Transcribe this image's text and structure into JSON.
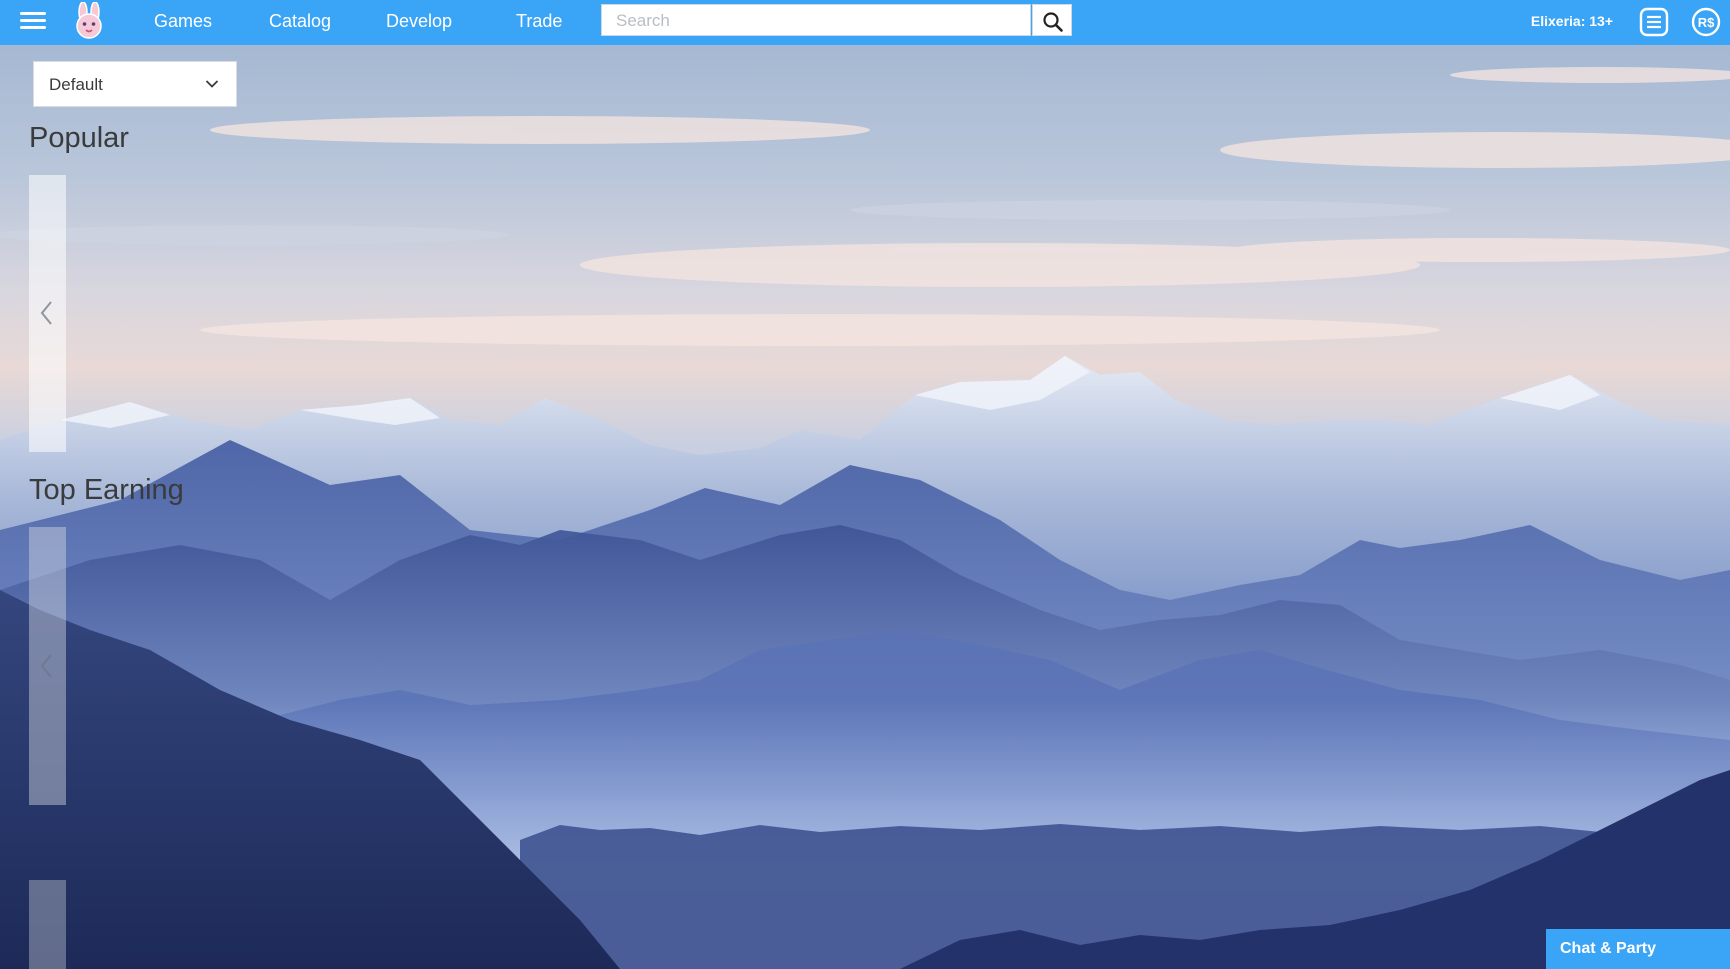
{
  "nav": {
    "games": "Games",
    "catalog": "Catalog",
    "develop": "Develop",
    "trade": "Trade",
    "user": "Elixeria: 13+",
    "icons": [
      "hamburger-icon",
      "bunny-logo-icon",
      "search-icon",
      "messages-icon",
      "robux-icon"
    ]
  },
  "search": {
    "placeholder": "Search",
    "value": ""
  },
  "sort": {
    "selected": "Default"
  },
  "sections": {
    "popular": "Popular",
    "top_earning": "Top Earning"
  },
  "chat": {
    "label": "Chat & Party"
  },
  "colors": {
    "accent": "#3aa5f7"
  }
}
